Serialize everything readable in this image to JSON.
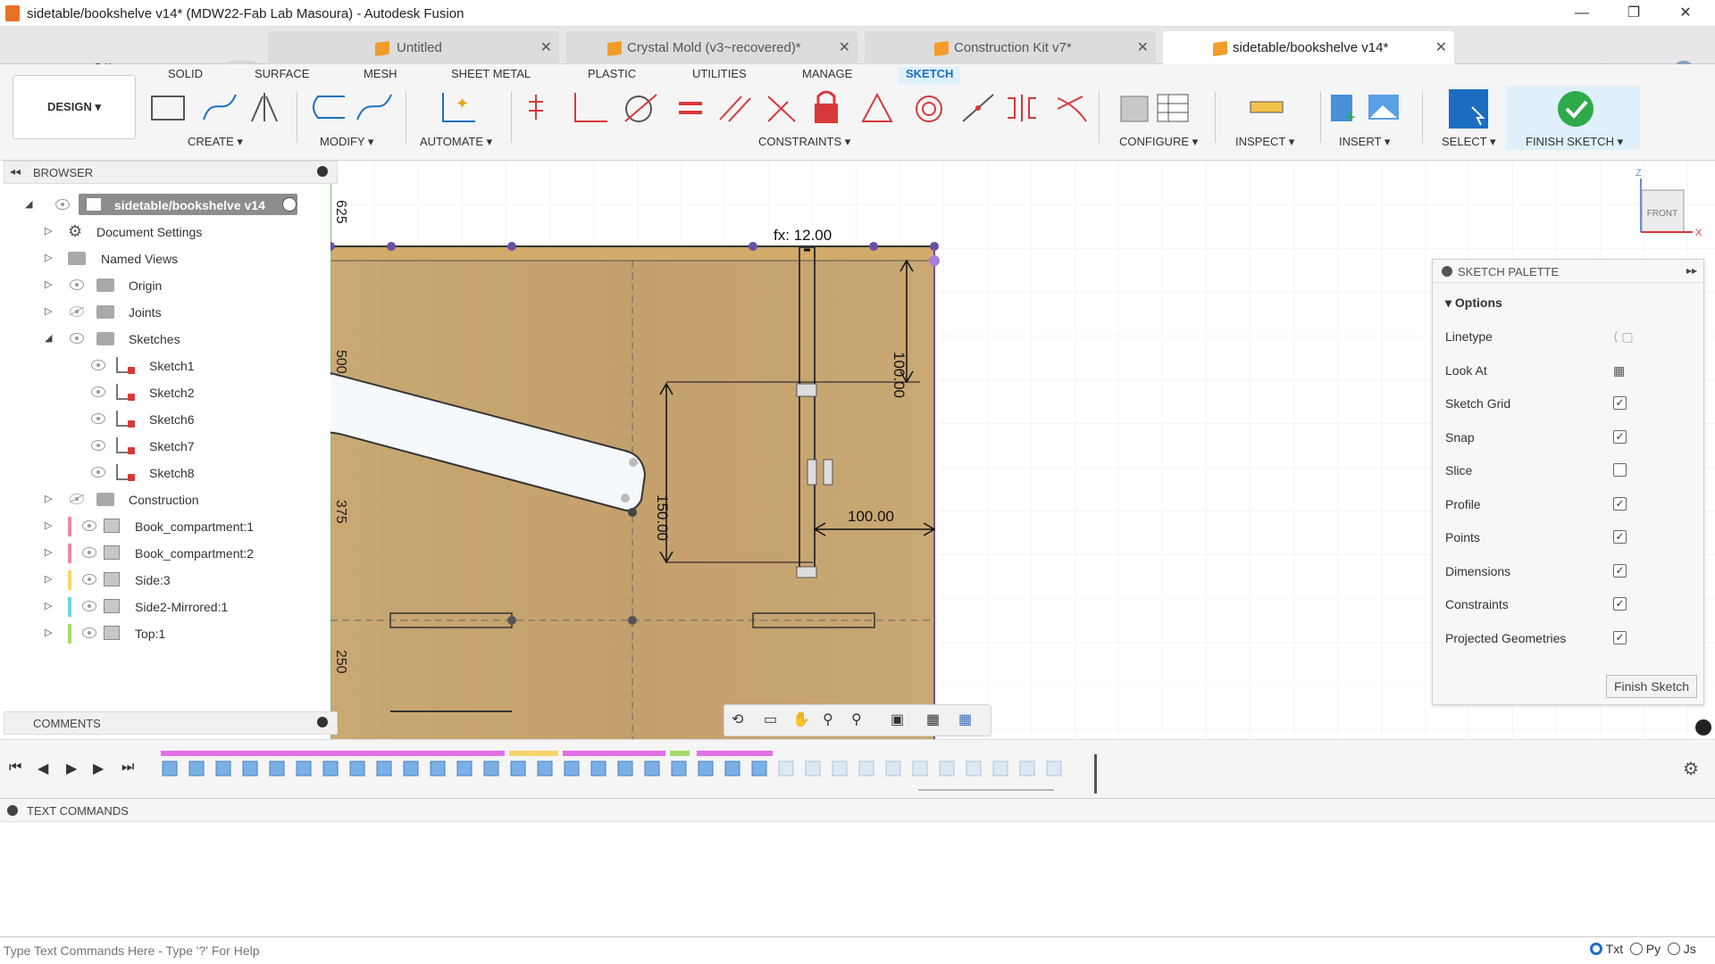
{
  "window": {
    "title": "sidetable/bookshelve v14* (MDW22-Fab Lab Masoura) - Autodesk Fusion",
    "minimize": "—",
    "maximize": "❐",
    "close": "✕"
  },
  "doc_tabs": [
    {
      "label": "Untitled",
      "active": false
    },
    {
      "label": "Crystal Mold (v3~recovered)*",
      "active": false
    },
    {
      "label": "Construction Kit v7*",
      "active": false
    },
    {
      "label": "sidetable/bookshelve v14*",
      "active": true
    }
  ],
  "tab_close": "✕",
  "tabbar_right": {
    "job_count": "1"
  },
  "workspace_menu": "DESIGN ▾",
  "workspace_tabs": [
    "SOLID",
    "SURFACE",
    "MESH",
    "SHEET METAL",
    "PLASTIC",
    "UTILITIES",
    "MANAGE",
    "SKETCH"
  ],
  "active_workspace_tab": "SKETCH",
  "tool_groups": {
    "create": "CREATE ▾",
    "modify": "MODIFY ▾",
    "automate": "AUTOMATE ▾",
    "constraints": "CONSTRAINTS ▾",
    "configure": "CONFIGURE ▾",
    "inspect": "INSPECT ▾",
    "insert": "INSERT ▾",
    "select": "SELECT ▾",
    "finish": "FINISH SKETCH ▾"
  },
  "browser": {
    "title": "BROWSER",
    "root": "sidetable/bookshelve v14",
    "items": [
      {
        "label": "Document Settings",
        "kind": "settings"
      },
      {
        "label": "Named Views",
        "kind": "folder"
      },
      {
        "label": "Origin",
        "kind": "folder"
      },
      {
        "label": "Joints",
        "kind": "folder"
      },
      {
        "label": "Sketches",
        "kind": "folder",
        "expanded": true
      },
      {
        "label": "Sketch1",
        "kind": "sketch"
      },
      {
        "label": "Sketch2",
        "kind": "sketch"
      },
      {
        "label": "Sketch6",
        "kind": "sketch"
      },
      {
        "label": "Sketch7",
        "kind": "sketch"
      },
      {
        "label": "Sketch8",
        "kind": "sketch"
      },
      {
        "label": "Construction",
        "kind": "folder"
      },
      {
        "label": "Book_compartment:1",
        "kind": "component",
        "color": "#e88aa0"
      },
      {
        "label": "Book_compartment:2",
        "kind": "component",
        "color": "#e88aa0"
      },
      {
        "label": "Side:3",
        "kind": "component",
        "color": "#f5d66b"
      },
      {
        "label": "Side2-Mirrored:1",
        "kind": "component",
        "color": "#6fd3e6"
      },
      {
        "label": "Top:1",
        "kind": "component",
        "color": "#a6d86b"
      }
    ]
  },
  "comments": {
    "title": "COMMENTS"
  },
  "canvas": {
    "dimensions": {
      "fx": "fx: 12.00",
      "d100_right": "100.00",
      "d150": "150.00",
      "d100_horiz": "100.00"
    },
    "ruler_labels": [
      "625",
      "500",
      "375",
      "250"
    ],
    "viewcube": {
      "face": "FRONT",
      "z": "Z",
      "x": "X"
    },
    "colors": {
      "wood": "#c9a874",
      "wood_dark": "#b89460",
      "grid": "#e8e8e8",
      "accent_purple": "#6b4fa3"
    }
  },
  "sketch_palette": {
    "title": "SKETCH PALETTE",
    "section": "Options",
    "rows": [
      {
        "label": "Linetype",
        "type": "icons"
      },
      {
        "label": "Look At",
        "type": "button"
      },
      {
        "label": "Sketch Grid",
        "type": "check",
        "checked": true
      },
      {
        "label": "Snap",
        "type": "check",
        "checked": true
      },
      {
        "label": "Slice",
        "type": "check",
        "checked": false
      },
      {
        "label": "Profile",
        "type": "check",
        "checked": true
      },
      {
        "label": "Points",
        "type": "check",
        "checked": true
      },
      {
        "label": "Dimensions",
        "type": "check",
        "checked": true
      },
      {
        "label": "Constraints",
        "type": "check",
        "checked": true
      },
      {
        "label": "Projected Geometries",
        "type": "check",
        "checked": true
      }
    ],
    "finish_button": "Finish Sketch"
  },
  "text_commands": {
    "title": "TEXT COMMANDS",
    "placeholder": "Type Text Commands Here - Type '?' For Help",
    "modes": [
      "Txt",
      "Py",
      "Js"
    ],
    "selected_mode": "Txt"
  }
}
